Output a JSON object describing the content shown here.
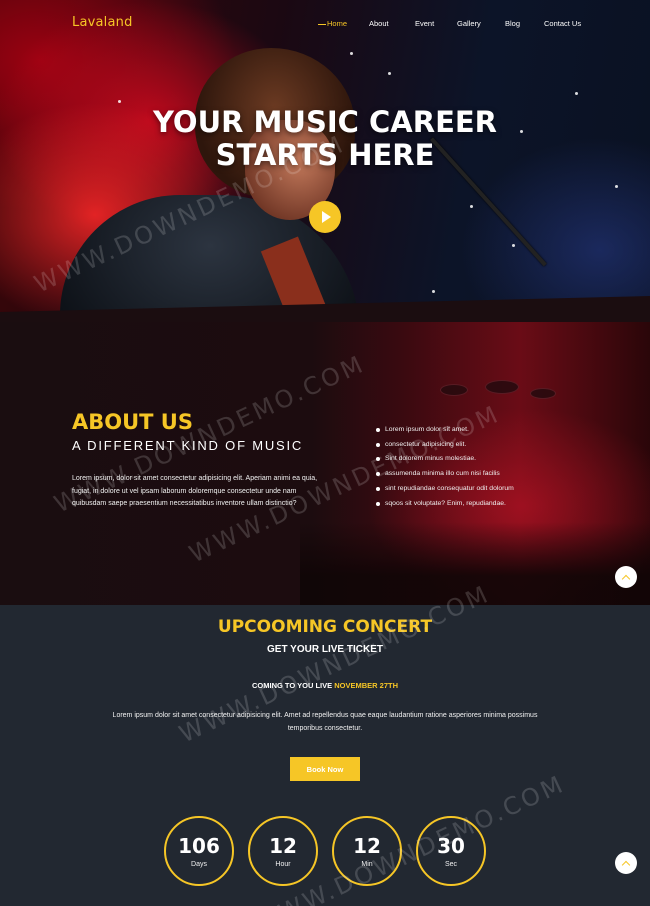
{
  "header": {
    "logo": "Lavaland",
    "nav": [
      {
        "label": "Home",
        "active": true
      },
      {
        "label": "About",
        "active": false
      },
      {
        "label": "Event",
        "active": false
      },
      {
        "label": "Gallery",
        "active": false
      },
      {
        "label": "Blog",
        "active": false
      },
      {
        "label": "Contact Us",
        "active": false
      }
    ]
  },
  "hero": {
    "title_line1": "YOUR MUSIC CAREER",
    "title_line2": "STARTS HERE",
    "play_icon": "play-icon"
  },
  "about": {
    "title": "ABOUT US",
    "subtitle": "A DIFFERENT KIND OF MUSIC",
    "text": "Lorem ipsum, dolor sit amet consectetur adipisicing elit. Aperiam animi ea quia, fugiat, in dolore ut vel ipsam laborum doloremque consectetur unde nam quibusdam saepe praesentium necessitatibus inventore ullam distinctio?",
    "list": [
      "Lorem ipsum dolor sit amet.",
      "consectetur adipisicing elit.",
      "Sint dolorem minus molestiae.",
      "assumenda minima illo cum nisi facilis",
      "sint repudiandae consequatur odit dolorum",
      "sqoos sit voluptate? Enim, repudiandae."
    ]
  },
  "concert": {
    "title": "UPCOOMING CONCERT",
    "subtitle": "GET YOUR LIVE TICKET",
    "coming_prefix": "COMING TO YOU LIVE",
    "coming_date": "NOVEMBER 27TH",
    "text": "Lorem ipsum dolor sit amet consectetur adipisicing elit. Amet ad repellendus quae eaque laudantium ratione asperiores minima possimus temporibus consectetur.",
    "book_label": "Book Now",
    "countdown": [
      {
        "value": "106",
        "label": "Days"
      },
      {
        "value": "12",
        "label": "Hour"
      },
      {
        "value": "12",
        "label": "Min"
      },
      {
        "value": "30",
        "label": "Sec"
      }
    ]
  },
  "scroll_top_icon": "chevron-up-icon",
  "watermark": "WWW.DOWNDEMO.COM",
  "colors": {
    "accent": "#f6c626",
    "background": "#222831",
    "about_bg": "#1a0d10"
  }
}
